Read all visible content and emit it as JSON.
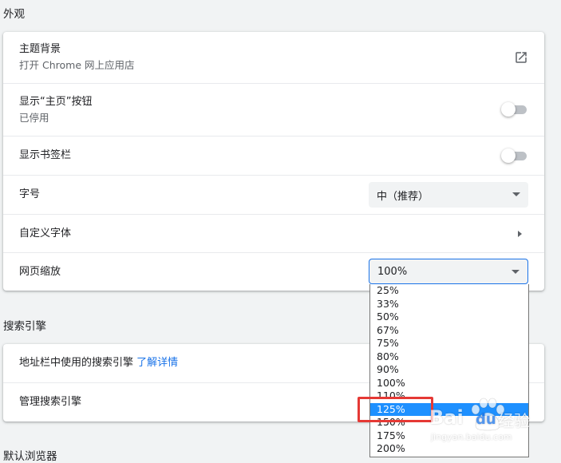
{
  "appearance": {
    "title": "外观",
    "theme": {
      "title": "主题背景",
      "subtitle": "打开 Chrome 网上应用店"
    },
    "home_button": {
      "title": "显示“主页”按钮",
      "subtitle": "已停用"
    },
    "bookmarks_bar": {
      "title": "显示书签栏"
    },
    "font_size": {
      "title": "字号",
      "value": "中（推荐）"
    },
    "custom_fonts": {
      "title": "自定义字体"
    },
    "page_zoom": {
      "title": "网页缩放",
      "value": "100%"
    }
  },
  "zoom_options": [
    "25%",
    "33%",
    "50%",
    "67%",
    "75%",
    "80%",
    "90%",
    "100%",
    "110%",
    "125%",
    "150%",
    "175%",
    "200%"
  ],
  "zoom_selected": "125%",
  "search_engine": {
    "title": "搜索引擎",
    "address_bar": {
      "title": "地址栏中使用的搜索引擎",
      "link": "了解详情"
    },
    "manage": {
      "title": "管理搜索引擎"
    }
  },
  "default_browser": {
    "title": "默认浏览器"
  },
  "watermark": {
    "brand": "Bai",
    "brand2": "du",
    "cn": "经验",
    "url": "jingyan.baidu.com"
  },
  "colors": {
    "accent": "#1a73e8",
    "selected_option": "#1e90ff",
    "highlight": "#e53935"
  }
}
